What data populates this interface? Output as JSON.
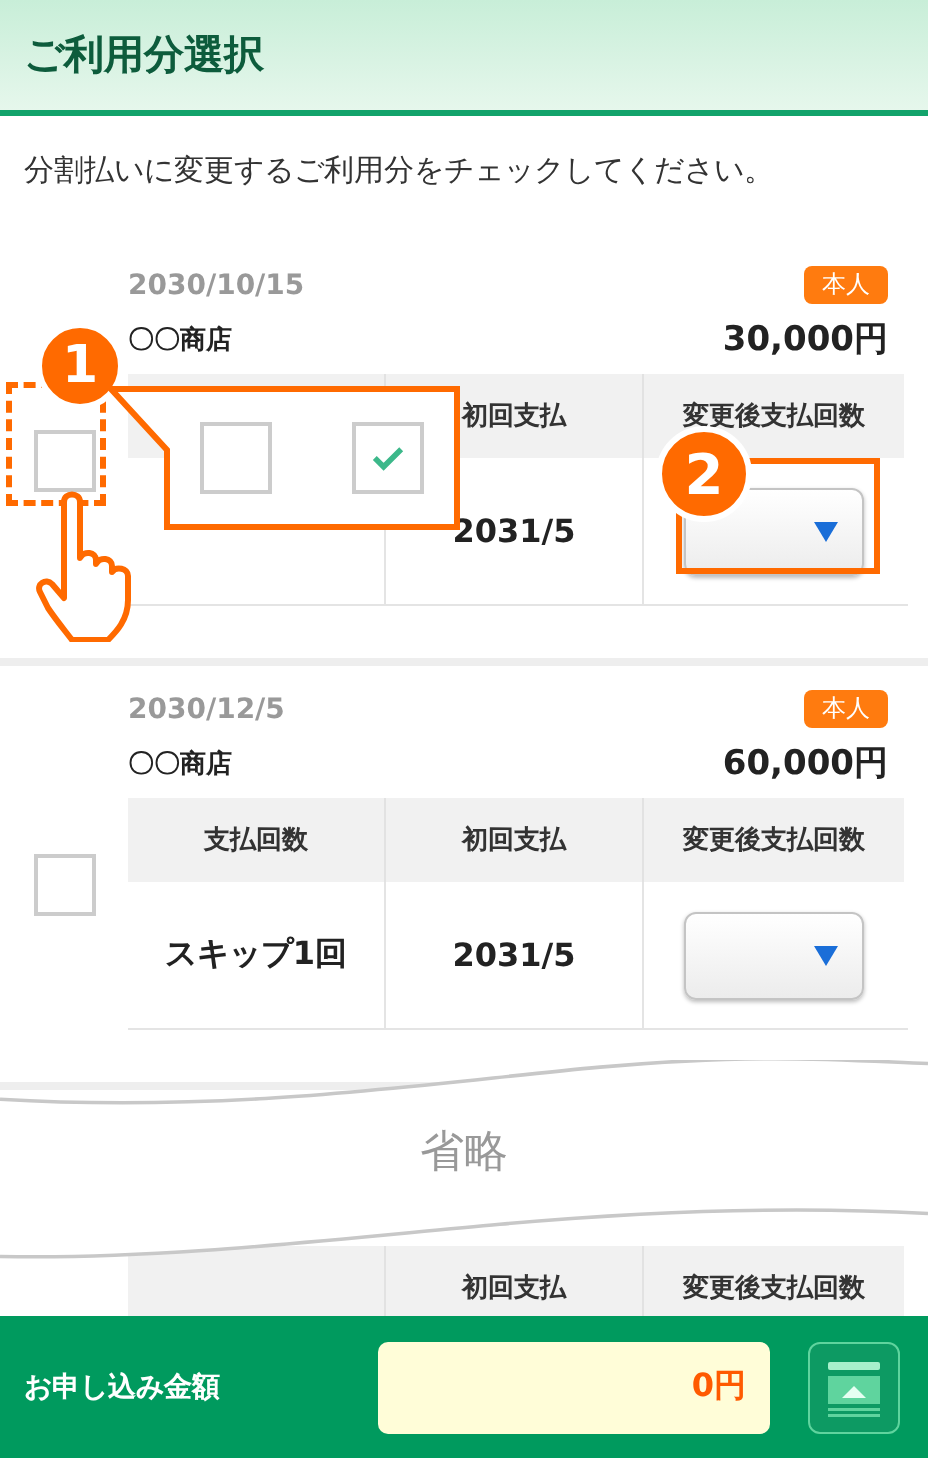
{
  "header": {
    "title": "ご利用分選択"
  },
  "instruction": "分割払いに変更するご利用分をチェックしてください。",
  "usages": [
    {
      "date": "2030/10/15",
      "tag": "本人",
      "store": "〇〇商店",
      "amount": "30,000円",
      "checked": false,
      "headers": [
        "初回支払",
        "変更後支払回数"
      ],
      "cells": [
        "2031/5"
      ]
    },
    {
      "date": "2030/12/5",
      "tag": "本人",
      "store": "〇〇商店",
      "amount": "60,000円",
      "checked": false,
      "headers": [
        "支払回数",
        "初回支払",
        "変更後支払回数"
      ],
      "cells": [
        "スキップ1回",
        "2031/5"
      ]
    }
  ],
  "omission": {
    "label": "省略",
    "partial_headers": [
      "初回支払",
      "変更後支払回数"
    ]
  },
  "annotations": {
    "step_1": {
      "number": "1",
      "examples": [
        {
          "checked": false
        },
        {
          "checked": true
        }
      ]
    },
    "step_2": {
      "number": "2"
    }
  },
  "footer": {
    "label": "お申し込み金額",
    "amount": "0円"
  }
}
